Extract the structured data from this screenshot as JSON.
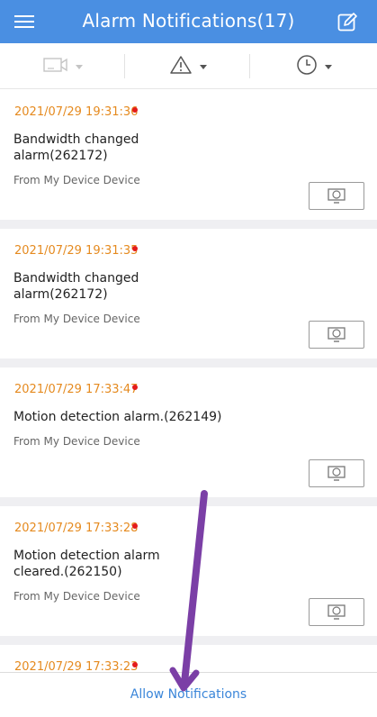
{
  "header": {
    "title": "Alarm Notifications(17)",
    "background_color": "#4a8fe2"
  },
  "filters": [
    {
      "icon": "camera-icon",
      "dropdown": "chevron-down-icon"
    },
    {
      "icon": "warning-icon",
      "dropdown": "chevron-down-icon"
    },
    {
      "icon": "clock-icon",
      "dropdown": "chevron-down-icon"
    }
  ],
  "alarms": [
    {
      "timestamp": "2021/07/29 19:31:36",
      "title": "Bandwidth changed alarm(262172)",
      "source": "From My Device Device",
      "unread": true
    },
    {
      "timestamp": "2021/07/29 19:31:35",
      "title": "Bandwidth changed alarm(262172)",
      "source": "From My Device Device",
      "unread": true
    },
    {
      "timestamp": "2021/07/29 17:33:47",
      "title": "Motion detection alarm.(262149)",
      "source": "From My Device Device",
      "unread": true
    },
    {
      "timestamp": "2021/07/29 17:33:28",
      "title": "Motion detection alarm cleared.(262150)",
      "source": "From My Device Device",
      "unread": true
    },
    {
      "timestamp": "2021/07/29 17:33:23",
      "unread": true
    }
  ],
  "footer": {
    "allow_notifications": "Allow Notifications"
  },
  "colors": {
    "timestamp": "#e58a1f",
    "unread_dot": "#e41b1b",
    "link": "#3b86d9",
    "annotation_arrow": "#7b3fa6"
  }
}
